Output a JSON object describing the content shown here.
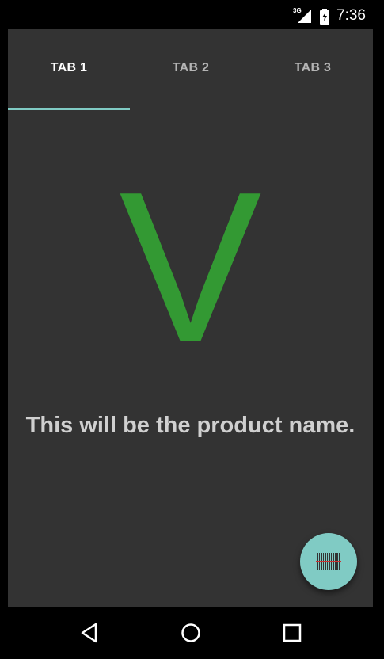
{
  "status_bar": {
    "network_label": "3G",
    "time": "7:36"
  },
  "tabs": [
    {
      "label": "TAB 1",
      "selected": true
    },
    {
      "label": "TAB 2",
      "selected": false
    },
    {
      "label": "TAB 3",
      "selected": false
    }
  ],
  "content": {
    "big_letter": "V",
    "product_name": "This will be the product name."
  },
  "fab": {
    "icon": "barcode-icon"
  },
  "nav_bar": {
    "icons": [
      "back-icon",
      "home-icon",
      "recents-icon"
    ]
  },
  "colors": {
    "background": "#333333",
    "accent": "#80cbc4",
    "letter": "#339933",
    "product_text": "#d0d0d0"
  }
}
